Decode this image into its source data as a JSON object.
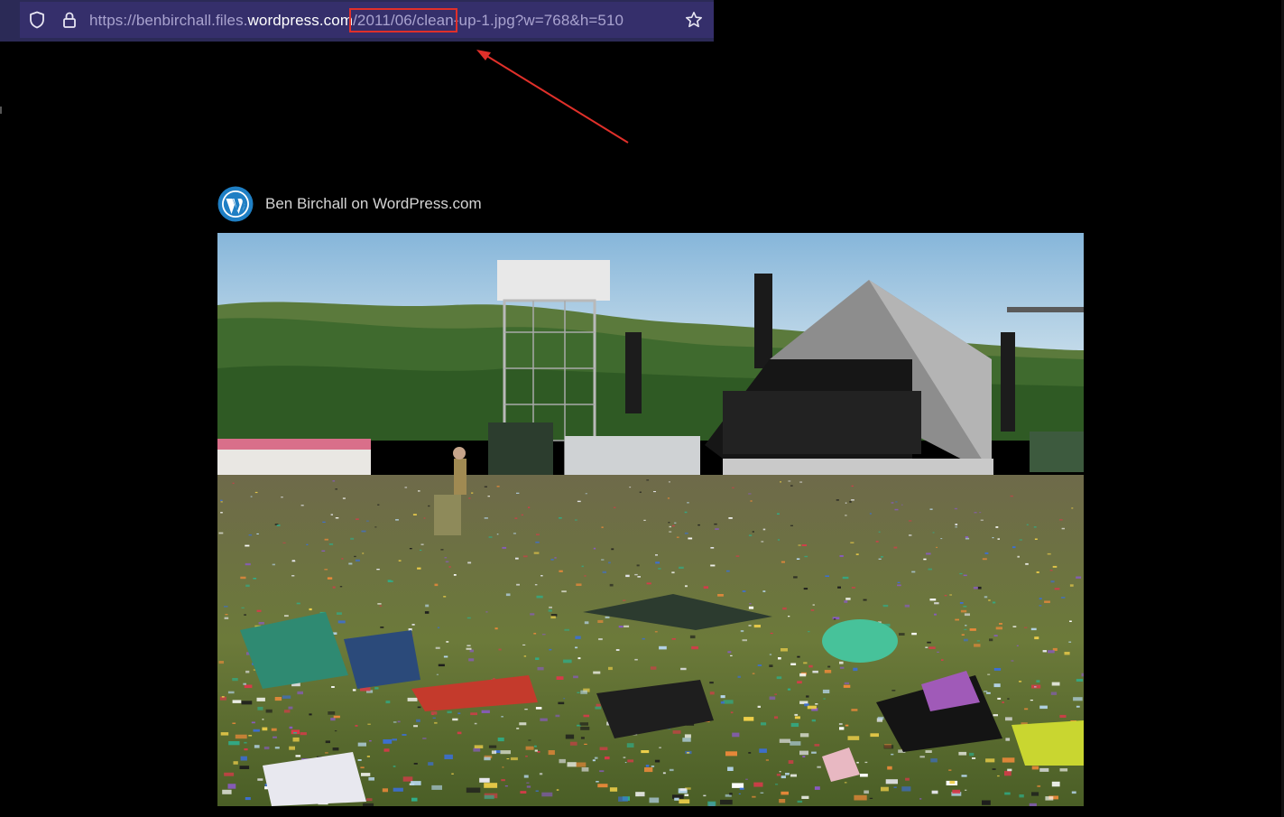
{
  "browser": {
    "url": {
      "prefix": "https://benbirchall.files.",
      "host_main": "wordpress.com",
      "path_highlighted": "/2011/06/clean",
      "path_rest": "-up-1.jpg?w=768&h=510"
    },
    "icons": [
      "shield-icon",
      "lock-icon",
      "star-icon"
    ],
    "colors": {
      "bar": "#2b2a56",
      "field": "#352f6b",
      "highlight": "#e0302a"
    }
  },
  "post": {
    "attribution": "Ben Birchall on WordPress.com",
    "logo_icon": "wordpress-logo-icon"
  },
  "photo": {
    "subject": "festival-field-litter-photo"
  }
}
